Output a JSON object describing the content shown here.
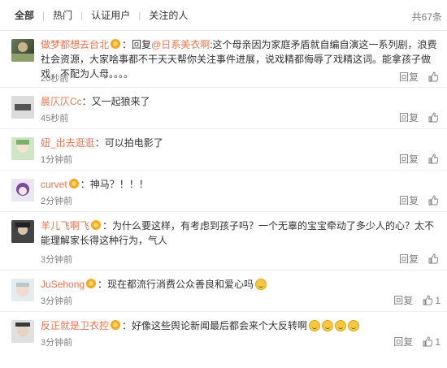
{
  "tabs": [
    "全部",
    "热门",
    "认证用户",
    "关注的人"
  ],
  "total": "共67条",
  "ui": {
    "reply": "回复"
  },
  "comments": [
    {
      "user": "做梦都想去台北",
      "vip": true,
      "content_prefix": "：回复",
      "mention": "@日系美衣啊",
      "content": ":这个母亲因为家庭矛盾就自编自演这一系列剧，浪费社会资源，大家啥事都不干天天帮你关注事件进展，说戏精都侮辱了戏精这词。能拿孩子做戏，不配为人母。。。。",
      "time": "20秒前",
      "likes": ""
    },
    {
      "user": "晨仄仄Cc",
      "vip": false,
      "content": "：又一起狼来了",
      "time": "45秒前",
      "likes": ""
    },
    {
      "user": "妞_出去逛逛",
      "vip": false,
      "content": "：可以拍电影了",
      "time": "1分钟前",
      "likes": ""
    },
    {
      "user": "curvet",
      "vip": true,
      "content": "：神马？！！！",
      "time": "2分钟前",
      "likes": ""
    },
    {
      "user": "羊儿飞啊飞",
      "vip": true,
      "content": "：为什么要这样，有考虑到孩子吗？一个无辜的宝宝牵动了多少人的心？太不能理解家长得这种行为，气人",
      "time": "3分钟前",
      "likes": ""
    },
    {
      "user": "JuSehong",
      "vip": true,
      "content": "：现在都流行消费公众善良和爱心吗",
      "emoji_count": 1,
      "time": "3分钟前",
      "likes": "1"
    },
    {
      "user": "反正就是卫衣控",
      "vip": true,
      "content": "：好像这些舆论新闻最后都会来个大反转啊",
      "emoji_count": 4,
      "time": "3分钟前",
      "likes": "1"
    }
  ]
}
